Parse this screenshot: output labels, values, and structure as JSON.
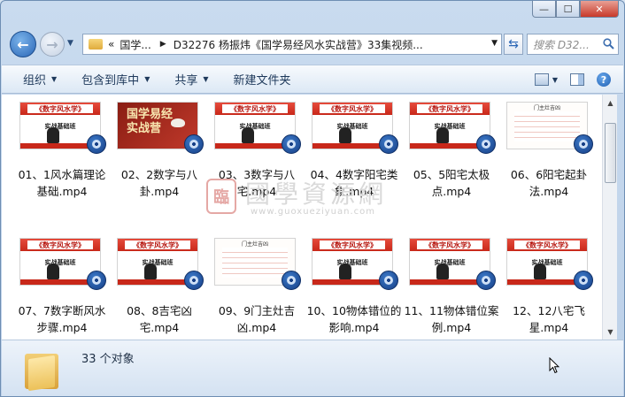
{
  "window": {
    "minimize_glyph": "—",
    "maximize_glyph": "☐",
    "close_glyph": "✕"
  },
  "nav": {
    "back_icon": "arrow-left-icon",
    "forward_icon": "arrow-right-icon",
    "address_prefix": "«",
    "crumb_1": "国学...",
    "crumb_2": "D32276 杨振炜《国学易经风水实战营》33集视频...",
    "search_placeholder": "搜索 D32..."
  },
  "toolbar": {
    "organize": "组织",
    "include_in_library": "包含到库中",
    "share": "共享",
    "new_folder": "新建文件夹"
  },
  "thumbnail_text": {
    "course_title": "《数字风水学》",
    "course_subtitle": "实战基础班",
    "red_title_line1": "国学易经",
    "red_title_line2": "实战营",
    "doc_header": "门主灶吉凶"
  },
  "files": [
    {
      "label": "01、1风水篇理论基础.mp4",
      "style": "standard"
    },
    {
      "label": "02、2数字与八卦.mp4",
      "style": "red"
    },
    {
      "label": "03、3数字与八宅.mp4",
      "style": "standard"
    },
    {
      "label": "04、4数字阳宅类象.mp4",
      "style": "standard"
    },
    {
      "label": "05、5阳宅太极点.mp4",
      "style": "standard"
    },
    {
      "label": "06、6阳宅起卦法.mp4",
      "style": "doc"
    },
    {
      "label": "07、7数字断风水步骤.mp4",
      "style": "standard"
    },
    {
      "label": "08、8吉宅凶宅.mp4",
      "style": "standard"
    },
    {
      "label": "09、9门主灶吉凶.mp4",
      "style": "doc"
    },
    {
      "label": "10、10物体错位的影响.mp4",
      "style": "standard"
    },
    {
      "label": "11、11物体错位案例.mp4",
      "style": "standard"
    },
    {
      "label": "12、12八宅飞星.mp4",
      "style": "standard"
    }
  ],
  "watermark": {
    "logo_char": "臨",
    "text": "國學資源網",
    "url": "www.guoxueziyuan.com"
  },
  "status": {
    "count_text": "33 个对象"
  }
}
